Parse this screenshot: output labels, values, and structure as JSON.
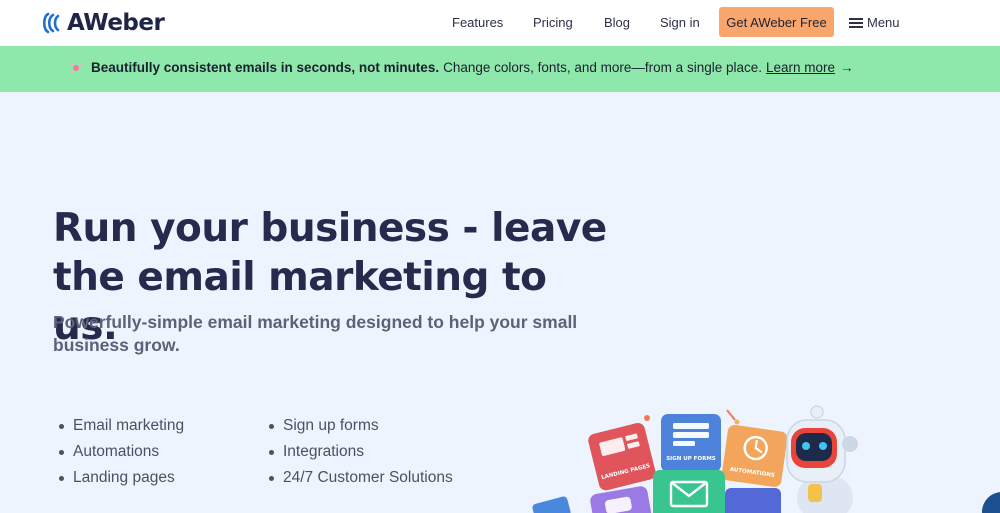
{
  "brand": {
    "name": "AWeber"
  },
  "nav": {
    "features": "Features",
    "pricing": "Pricing",
    "blog": "Blog",
    "sign_in": "Sign in",
    "cta": "Get AWeber Free",
    "menu": "Menu"
  },
  "banner": {
    "strong": "Beautifully consistent emails in seconds, not minutes.",
    "text": "Change colors, fonts, and more—from a single place.",
    "link": "Learn more",
    "arrow": "→"
  },
  "hero": {
    "title_line1": "Run your business - leave",
    "title_line2": "the email marketing to us.",
    "subtitle_line1": "Powerfully-simple email marketing designed to help your small",
    "subtitle_line2": "business grow."
  },
  "features": {
    "col1": [
      "Email marketing",
      "Automations",
      "Landing pages"
    ],
    "col2": [
      "Sign up forms",
      "Integrations",
      "24/7 Customer Solutions"
    ]
  },
  "illustration": {
    "tiles": {
      "landing": "LANDING PAGES",
      "signup": "SIGN UP FORMS",
      "automations": "AUTOMATIONS"
    }
  },
  "colors": {
    "brand_blue": "#1f6fd1",
    "cta": "#f9a66c",
    "banner": "#8fe8ab",
    "hero_bg": "#eef4fd",
    "heading": "#262b4e"
  }
}
